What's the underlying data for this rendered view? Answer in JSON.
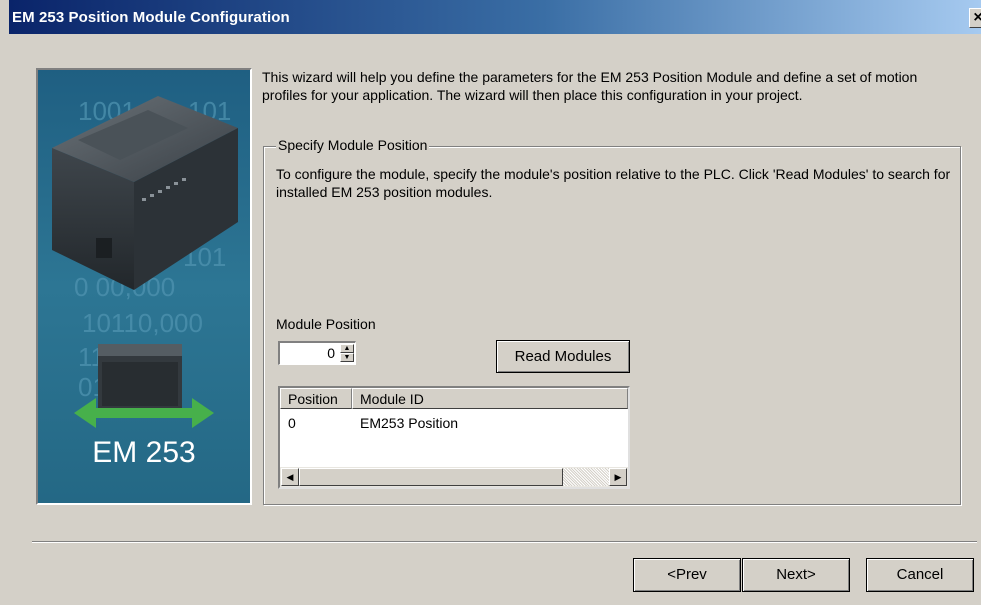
{
  "window": {
    "title": "EM 253 Position Module Configuration",
    "close_label": "×"
  },
  "intro": "This wizard will help you define the parameters for the EM 253 Position Module and define a set of motion profiles for your application.  The wizard will then place this configuration in your project.",
  "sidebar_image": {
    "product_label": "EM 253",
    "bg_digits": [
      "1001",
      "101",
      "101",
      "0 00,000",
      "10110,000",
      "1101010",
      "0101010"
    ]
  },
  "group": {
    "legend": "Specify Module Position",
    "description": "To configure the module, specify the module's position relative to the PLC. Click 'Read Modules' to search for installed EM 253 position modules."
  },
  "module_position": {
    "label": "Module Position",
    "value": "0"
  },
  "read_modules_label": "Read Modules",
  "list": {
    "columns": [
      "Position",
      "Module ID"
    ],
    "rows": [
      {
        "position": "0",
        "module_id": "EM253 Position"
      }
    ]
  },
  "nav": {
    "prev": "<Prev",
    "next": "Next>",
    "cancel": "Cancel"
  },
  "colors": {
    "titlebar_start": "#0a246a",
    "titlebar_end": "#a6caf0",
    "dialog_bg": "#d4d0c8",
    "image_bg": "#2a6e8c"
  }
}
